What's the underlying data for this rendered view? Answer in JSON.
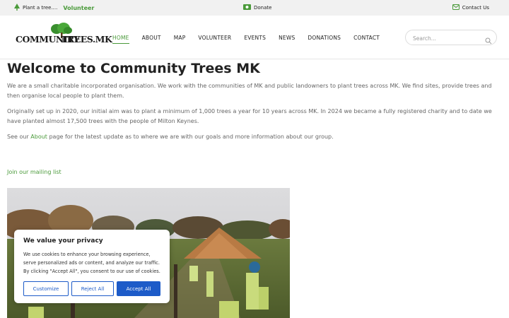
{
  "topbar": {
    "plant_text": "Plant a tree....",
    "volunteer": "Volunteer",
    "donate": "Donate",
    "contact": "Contact Us"
  },
  "logo": {
    "left_word": "COMMUNITY",
    "right_word": "TREES.MK"
  },
  "nav": {
    "items": [
      "HOME",
      "ABOUT",
      "MAP",
      "VOLUNTEER",
      "EVENTS",
      "NEWS",
      "DONATIONS",
      "CONTACT"
    ],
    "active": "HOME"
  },
  "search": {
    "placeholder": "Search..."
  },
  "main": {
    "title": "Welcome to Community Trees MK",
    "para1": "We are a small charitable incorporated organisation. We work with the communities of MK and public landowners to plant trees across MK. We find sites, provide trees and then organise local people to plant them.",
    "para2": "Originally set up in 2020, our initial aim was to plant a minimum of 1,000 trees a year for 10 years across MK. In 2024 we became a fully registered charity and to date we have planted almost 17,500 trees with the people of Milton Keynes.",
    "para3_before": "See our ",
    "para3_link": "About",
    "para3_after": " page for the latest update as to where we are with our goals and more information about our group.",
    "mailing_link": "Join our mailing list"
  },
  "cookie": {
    "title": "We value your privacy",
    "text": "We use cookies to enhance your browsing experience, serve personalized ads or content, and analyze our traffic. By clicking \"Accept All\", you consent to our use of cookies.",
    "customize": "Customize",
    "reject": "Reject All",
    "accept": "Accept All"
  },
  "colors": {
    "brand_green": "#4a9a3a",
    "button_blue": "#1d5bc8"
  },
  "icons": [
    "tree-icon",
    "money-icon",
    "mail-icon",
    "search-icon"
  ]
}
